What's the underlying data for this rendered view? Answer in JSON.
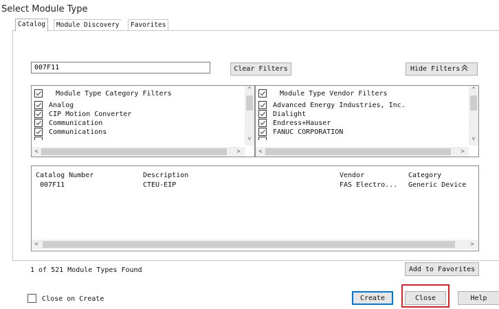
{
  "window": {
    "title": "Select Module Type"
  },
  "tabs": [
    {
      "label": "Catalog"
    },
    {
      "label": "Module Discovery"
    },
    {
      "label": "Favorites"
    }
  ],
  "search": {
    "value": "007F11"
  },
  "buttons": {
    "clear_filters": "Clear Filters",
    "hide_filters": "Hide Filters",
    "add_to_favorites": "Add to Favorites",
    "create": "Create",
    "close": "Close",
    "help": "Help"
  },
  "category_filters": {
    "header": "Module Type Category Filters",
    "items": [
      {
        "label": "Analog",
        "checked": true
      },
      {
        "label": "CIP Motion Converter",
        "checked": true
      },
      {
        "label": "Communication",
        "checked": true
      },
      {
        "label": "Communications",
        "checked": true
      }
    ]
  },
  "vendor_filters": {
    "header": "Module Type Vendor Filters",
    "items": [
      {
        "label": "Advanced Energy Industries, Inc.",
        "checked": true
      },
      {
        "label": "Dialight",
        "checked": true
      },
      {
        "label": "Endress+Hauser",
        "checked": true
      },
      {
        "label": "FANUC CORPORATION",
        "checked": true
      }
    ]
  },
  "results_table": {
    "columns": [
      "Catalog Number",
      "Description",
      "Vendor",
      "Category"
    ],
    "rows": [
      {
        "catalog_number": "007F11",
        "description": "CTEU-EIP",
        "vendor": "FAS Electro...",
        "category": "Generic Device(ke"
      }
    ]
  },
  "status": {
    "found_text": "1 of 521 Module Types Found"
  },
  "close_on_create": {
    "label": "Close on Create",
    "checked": false
  },
  "colors": {
    "highlight": "#e02020",
    "accent": "#0078d7"
  }
}
